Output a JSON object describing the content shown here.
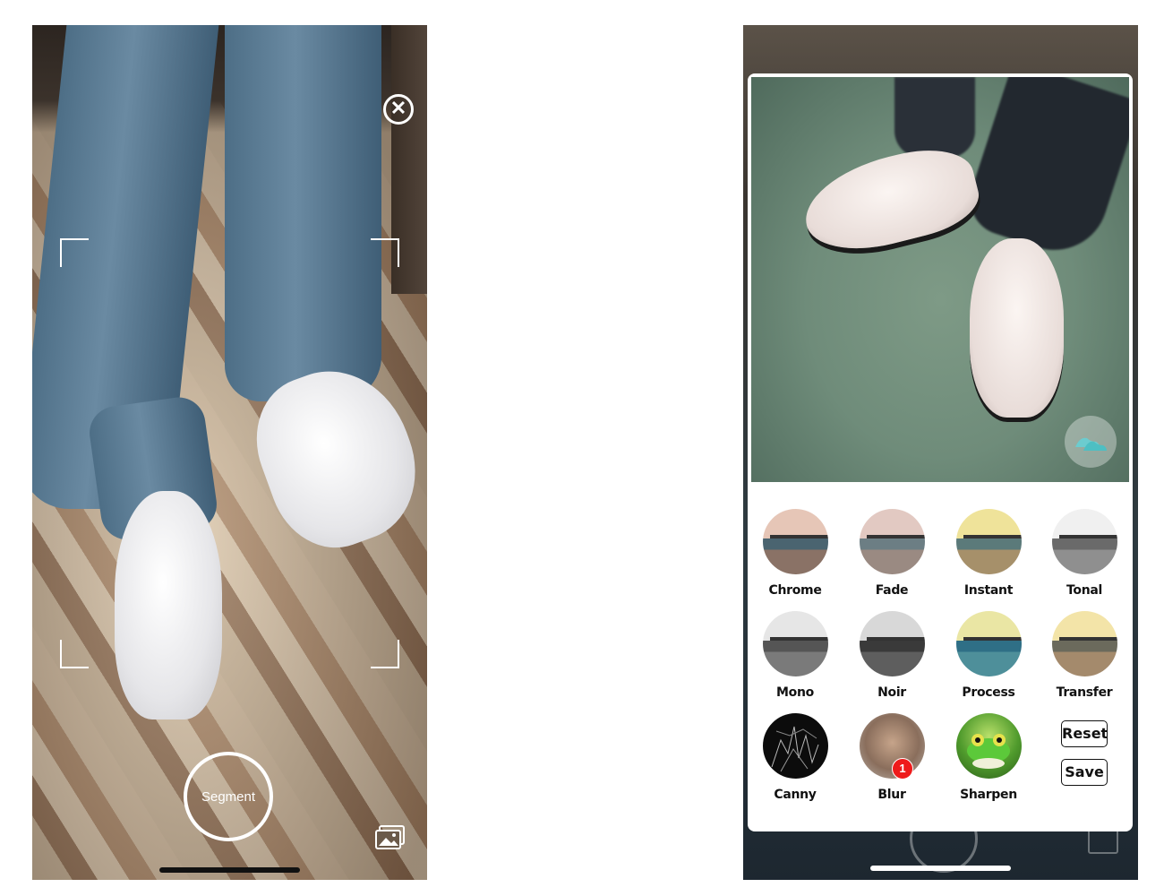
{
  "left_screen": {
    "close_icon": "close-circle-icon",
    "segment_button_label": "Segment",
    "gallery_icon": "photo-gallery-icon"
  },
  "right_screen": {
    "preview_badge_icon": "shoes-icon",
    "filters": [
      {
        "label": "Chrome",
        "sky": "#e6c6b7",
        "sea": "#4a6470",
        "sand": "#8a7266"
      },
      {
        "label": "Fade",
        "sky": "#e2c9c2",
        "sea": "#6c7e84",
        "sand": "#9a8a82"
      },
      {
        "label": "Instant",
        "sky": "#efe39a",
        "sea": "#5b7a7a",
        "sand": "#a6906a"
      },
      {
        "label": "Tonal",
        "sky": "#f0f0f0",
        "sea": "#6a6a6a",
        "sand": "#8f8f8f"
      },
      {
        "label": "Mono",
        "sky": "#e6e6e6",
        "sea": "#555555",
        "sand": "#7a7a7a"
      },
      {
        "label": "Noir",
        "sky": "#d8d8d8",
        "sea": "#3a3a3a",
        "sand": "#5e5e5e"
      },
      {
        "label": "Process",
        "sky": "#eae6a4",
        "sea": "#2f6f86",
        "sand": "#4e8f9a"
      },
      {
        "label": "Transfer",
        "sky": "#f3e4a8",
        "sea": "#6b6a5c",
        "sand": "#a48a6c"
      },
      {
        "label": "Canny",
        "style": "edges"
      },
      {
        "label": "Blur",
        "style": "blur",
        "badge": "1"
      },
      {
        "label": "Sharpen",
        "style": "frog"
      }
    ],
    "reset_label": "Reset",
    "save_label": "Save"
  },
  "colors": {
    "badge_red": "#ee1b1b",
    "text_dark": "#111111"
  }
}
